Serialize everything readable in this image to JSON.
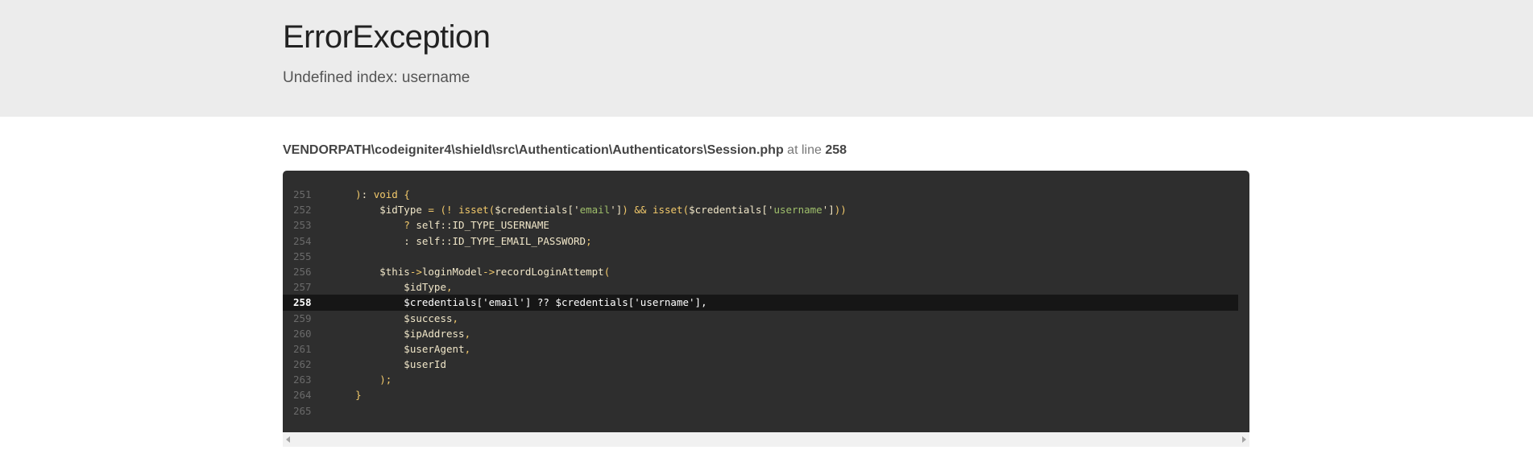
{
  "header": {
    "title": "ErrorException",
    "message": "Undefined index: username"
  },
  "file": {
    "path": "VENDORPATH\\codeigniter4\\shield\\src\\Authentication\\Authenticators\\Session.php",
    "at_line_label": "at line",
    "line": "258"
  },
  "source": {
    "highlight_line": "258",
    "lines": [
      {
        "num": "251",
        "code": "    ): void {"
      },
      {
        "num": "252",
        "code": "        $idType = (! isset($credentials['email']) && isset($credentials['username']))"
      },
      {
        "num": "253",
        "code": "            ? self::ID_TYPE_USERNAME"
      },
      {
        "num": "254",
        "code": "            : self::ID_TYPE_EMAIL_PASSWORD;"
      },
      {
        "num": "255",
        "code": ""
      },
      {
        "num": "256",
        "code": "        $this->loginModel->recordLoginAttempt("
      },
      {
        "num": "257",
        "code": "            $idType,"
      },
      {
        "num": "258",
        "code": "            $credentials['email'] ?? $credentials['username'],"
      },
      {
        "num": "259",
        "code": "            $success,"
      },
      {
        "num": "260",
        "code": "            $ipAddress,"
      },
      {
        "num": "261",
        "code": "            $userAgent,"
      },
      {
        "num": "262",
        "code": "            $userId"
      },
      {
        "num": "263",
        "code": "        );"
      },
      {
        "num": "264",
        "code": "    }"
      },
      {
        "num": "265",
        "code": ""
      }
    ]
  },
  "scrollbar": {
    "left_icon": "arrow-left-icon",
    "right_icon": "arrow-right-icon"
  }
}
